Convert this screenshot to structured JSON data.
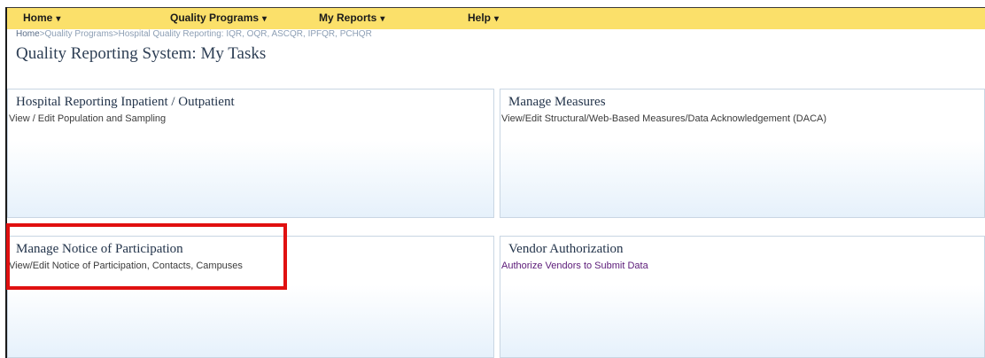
{
  "nav": {
    "items": [
      {
        "label": "Home",
        "caret": "▾"
      },
      {
        "label": "Quality Programs",
        "caret": "▾"
      },
      {
        "label": "My Reports",
        "caret": "▾"
      },
      {
        "label": "Help",
        "caret": "▾"
      }
    ]
  },
  "breadcrumb": {
    "home": "Home",
    "separator": ">",
    "items": [
      "Quality Programs",
      "Hospital Quality Reporting: IQR, OQR, ASCQR, IPFQR, PCHQR"
    ]
  },
  "page": {
    "title": "Quality Reporting System: My Tasks"
  },
  "panels": [
    {
      "title": "Hospital Reporting Inpatient / Outpatient",
      "description": "View / Edit Population and Sampling"
    },
    {
      "title": "Manage Measures",
      "description": "View/Edit Structural/Web-Based Measures/Data Acknowledgement (DACA)"
    },
    {
      "title": "Manage Notice of Participation",
      "description": "View/Edit Notice of Participation, Contacts, Campuses"
    },
    {
      "title": "Vendor Authorization",
      "description": "Authorize Vendors to Submit Data"
    }
  ],
  "colors": {
    "navbar": "#fbe06a",
    "highlight": "#e01010",
    "link": "#5b1a78"
  },
  "icons": {
    "dropdown": "chevron-down-icon"
  }
}
